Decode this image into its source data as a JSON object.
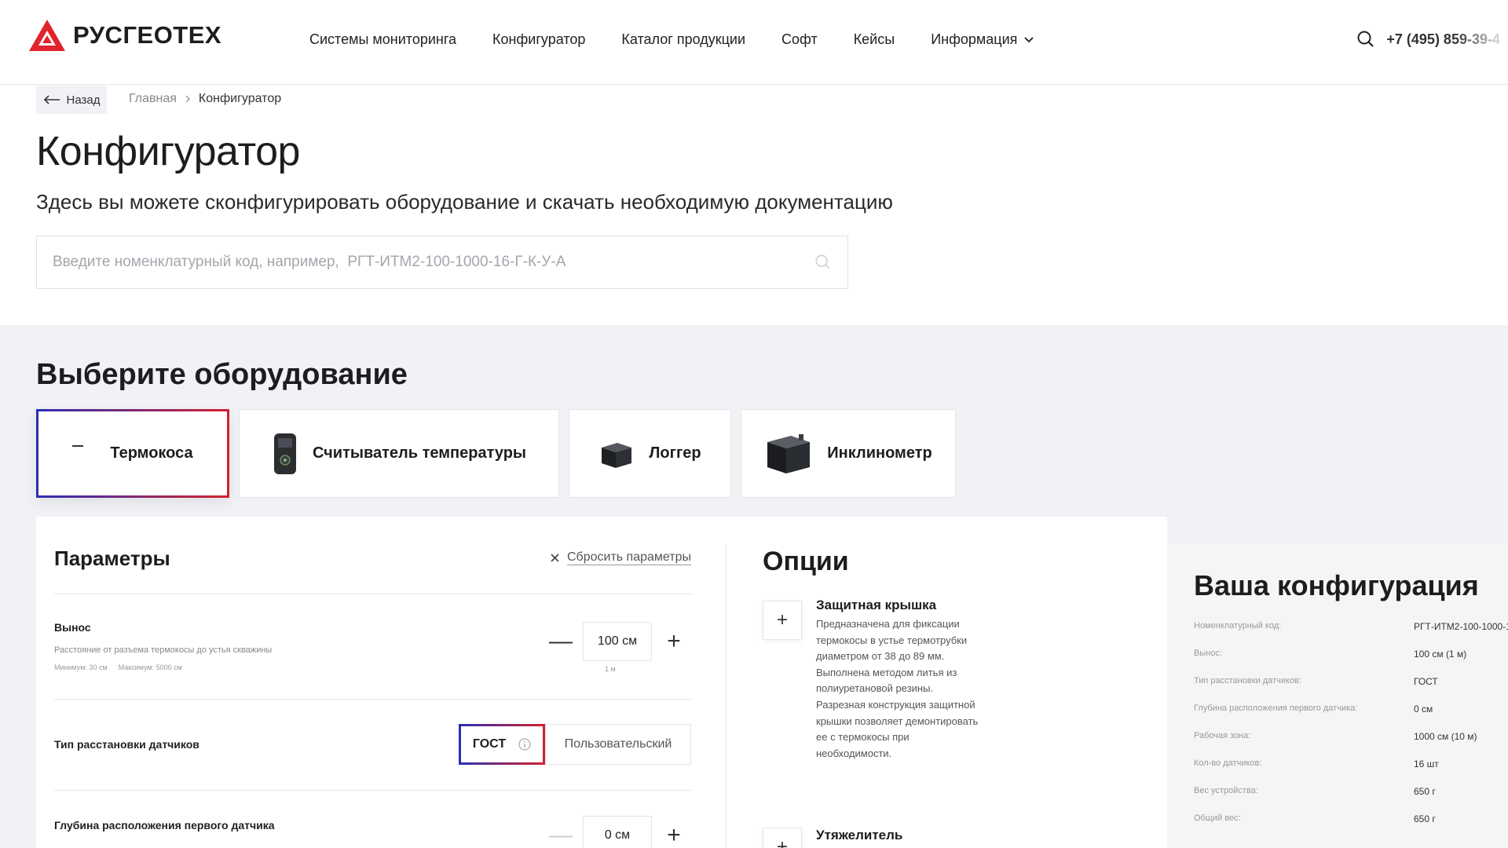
{
  "header": {
    "logo_text": "РУСГЕОТЕХ",
    "nav": [
      {
        "label": "Системы мониторинга"
      },
      {
        "label": "Конфигуратор"
      },
      {
        "label": "Каталог продукции"
      },
      {
        "label": "Софт"
      },
      {
        "label": "Кейсы"
      },
      {
        "label": "Информация"
      }
    ],
    "phone": "+7 (495) 859-39-4"
  },
  "breadcrumb": {
    "back_label": "Назад",
    "items": [
      "Главная",
      "Конфигуратор"
    ]
  },
  "page": {
    "title": "Конфигуратор",
    "subtitle": "Здесь вы можете сконфигурировать оборудование и скачать необходимую документацию"
  },
  "search": {
    "placeholder": "Введите номенклатурный код, например,  РГТ-ИТМ2-100-1000-16-Г-К-У-А"
  },
  "equipment": {
    "title": "Выберите оборудование",
    "items": [
      {
        "label": "Термокоса",
        "active": true
      },
      {
        "label": "Считыватель температуры"
      },
      {
        "label": "Логгер"
      },
      {
        "label": "Инклинометр"
      }
    ]
  },
  "params": {
    "title": "Параметры",
    "reset_label": "Сбросить параметры",
    "offset": {
      "label": "Вынос",
      "desc": "Расстояние от разъема термокосы до устья скважины",
      "min": "Минимум: 30 см",
      "max": "Максимум: 5000 см",
      "value": "100 см",
      "sub": "1 м"
    },
    "sensor_type": {
      "label": "Тип расстановки датчиков",
      "options": [
        "ГОСТ",
        "Пользовательский"
      ],
      "selected": "ГОСТ"
    },
    "first_depth": {
      "label": "Глубина расположения первого датчика",
      "value": "0 см"
    }
  },
  "options": {
    "title": "Опции",
    "items": [
      {
        "name": "Защитная крышка",
        "desc": "Предназначена для фиксации термокосы в устье термотрубки диаметром от 38 до 89 мм. Выполнена методом литья из полиуретановой резины. Разрезная конструкция защитной крышки позволяет демонтировать ее с термокосы при необходимости."
      },
      {
        "name": "Утяжелитель"
      }
    ]
  },
  "config": {
    "title": "Ваша конфигурация",
    "rows": [
      {
        "k": "Номенклатурный код:",
        "v": "РГТ-ИТМ2-100-1000-1"
      },
      {
        "k": "Вынос:",
        "v": "100 см (1 м)"
      },
      {
        "k": "Тип расстановки датчиков:",
        "v": "ГОСТ"
      },
      {
        "k": "Глубина расположения первого датчика:",
        "v": "0 см"
      },
      {
        "k": "Рабочая зона:",
        "v": "1000 см (10 м)"
      },
      {
        "k": "Кол-во датчиков:",
        "v": "16 шт"
      },
      {
        "k": "Вес устройства:",
        "v": "650 г"
      },
      {
        "k": "Общий вес:",
        "v": "650 г"
      }
    ]
  }
}
